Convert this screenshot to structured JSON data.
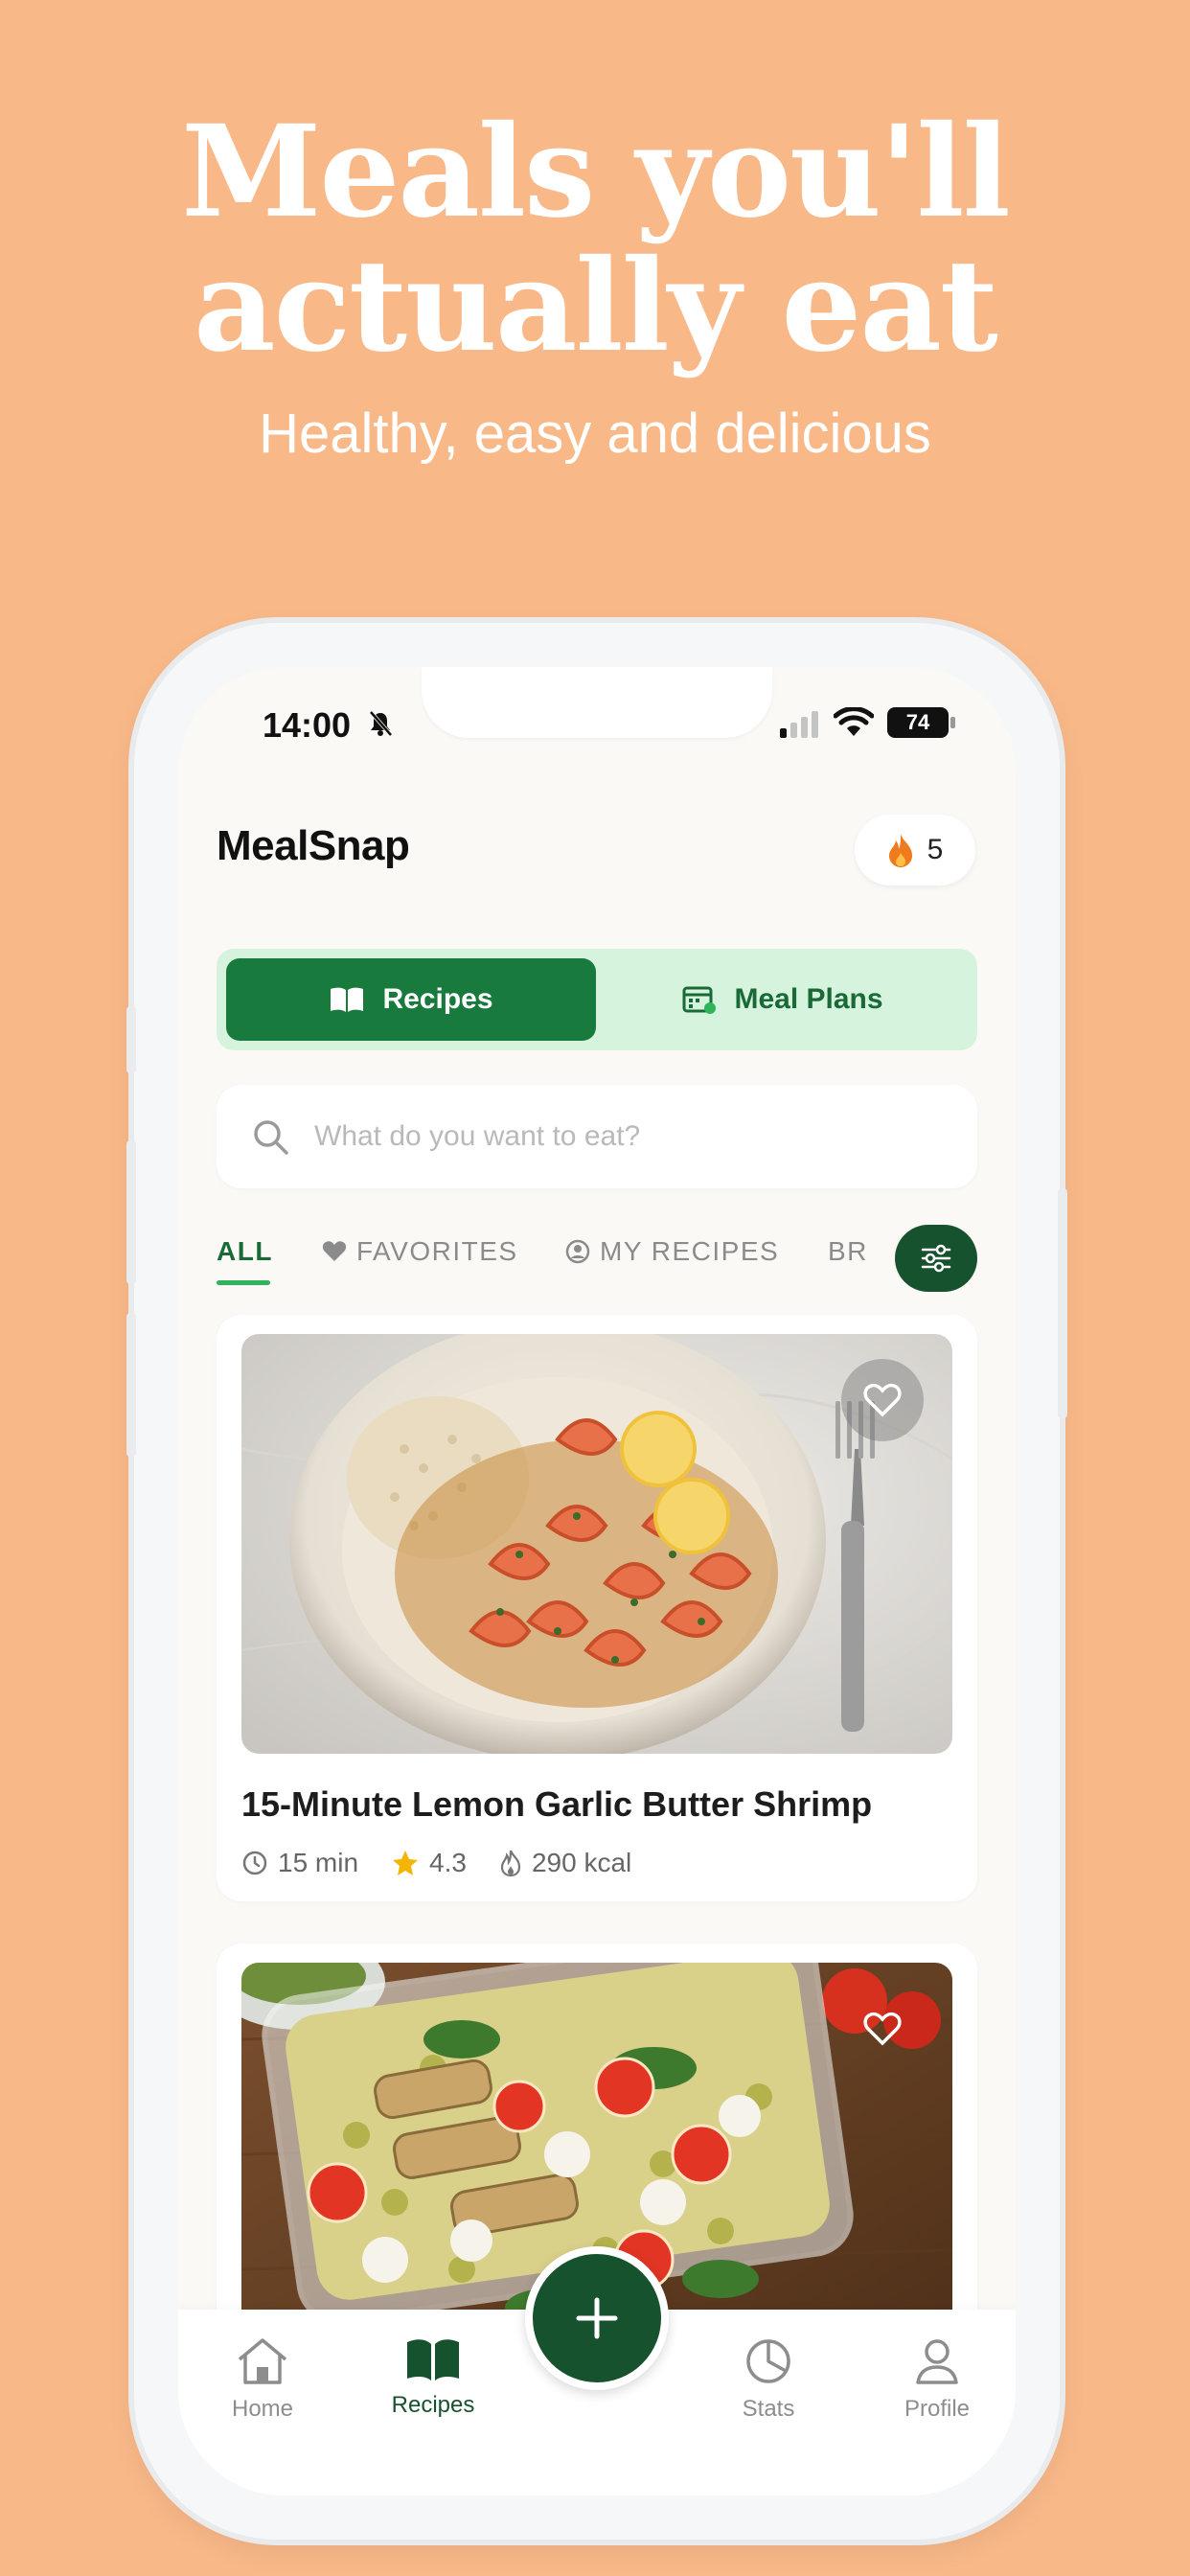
{
  "hero": {
    "title_line1": "Meals you'll",
    "title_line2": "actually eat",
    "subtitle": "Healthy, easy and delicious"
  },
  "status_bar": {
    "time": "14:00",
    "battery": "74"
  },
  "app": {
    "logo": "MealSnap",
    "streak_count": "5"
  },
  "segments": {
    "recipes": "Recipes",
    "meal_plans": "Meal Plans"
  },
  "search": {
    "placeholder": "What do you want to eat?"
  },
  "tabs": {
    "all": "ALL",
    "favorites": "FAVORITES",
    "my_recipes": "MY RECIPES",
    "breakfast": "BRE"
  },
  "cards": [
    {
      "title": "15-Minute Lemon Garlic Butter Shrimp",
      "time": "15 min",
      "rating": "4.3",
      "calories": "290 kcal"
    },
    {
      "title": "",
      "time": "",
      "rating": "",
      "calories": ""
    }
  ],
  "nav": {
    "home": "Home",
    "recipes": "Recipes",
    "stats": "Stats",
    "profile": "Profile"
  },
  "colors": {
    "background": "#F8B888",
    "primary_green": "#197a3d",
    "dark_green": "#17522f",
    "segment_bg": "#d6f3dd",
    "accent_orange": "#f07a1e",
    "star_yellow": "#f4b400"
  },
  "icons": {
    "notification": "bell-slash-icon",
    "streak": "flame-icon",
    "recipes": "open-book-icon",
    "meal_plans": "calendar-icon",
    "search": "search-icon",
    "favorites": "heart-icon",
    "my_recipes": "user-circle-icon",
    "filter": "sliders-icon",
    "time": "clock-icon",
    "rating": "star-icon",
    "calories": "flame-outline-icon",
    "home": "home-icon",
    "add": "plus-icon",
    "stats": "pie-chart-icon",
    "profile": "person-icon"
  }
}
